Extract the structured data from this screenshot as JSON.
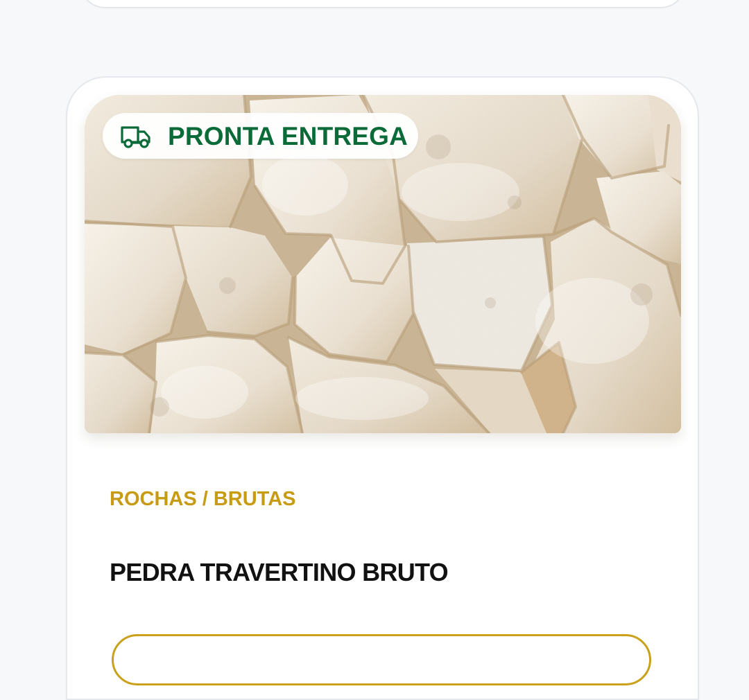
{
  "badge": {
    "label": "PRONTA ENTREGA",
    "icon": "truck-icon",
    "color": "#0a6a38"
  },
  "product": {
    "category": "ROCHAS / BRUTAS",
    "name": "PEDRA TRAVERTINO BRUTO",
    "image_icon": "stone-image"
  },
  "colors": {
    "category": "#c79b13",
    "button_border": "#c9a11a",
    "page_background": "#f6f8fa"
  }
}
